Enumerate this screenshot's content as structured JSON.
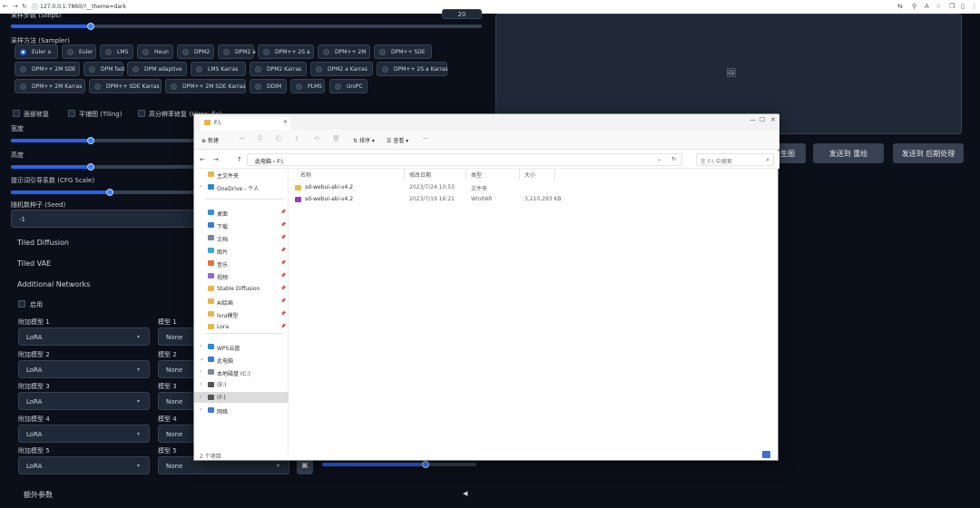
{
  "browser": {
    "url": "127.0.0.1:7860/?__theme=dark",
    "controls": [
      "←",
      "→",
      "↻",
      "ⓘ"
    ],
    "right_icons": [
      "⇆",
      "⚲",
      "A",
      "☆",
      "❒",
      "▯",
      "⋮"
    ]
  },
  "left": {
    "sampling_steps_label": "采样步数 (Steps)",
    "sampling_steps_value": "20",
    "sampling_steps_fraction": 0.17,
    "sampler_label": "采样方法 (Sampler)",
    "samplers": [
      "Euler a",
      "Euler",
      "LMS",
      "Heun",
      "DPM2",
      "DPM2 a",
      "DPM++ 2S a",
      "DPM++ 2M",
      "DPM++ SDE",
      "DPM++ 2M SDE",
      "DPM fast",
      "DPM adaptive",
      "LMS Karras",
      "DPM2 Karras",
      "DPM2 a Karras",
      "DPM++ 2S a Karras",
      "DPM++ 2M Karras",
      "DPM++ SDE Karras",
      "DPM++ 2M SDE Karras",
      "DDIM",
      "PLMS",
      "UniPC"
    ],
    "selected_sampler": "Euler a",
    "checkboxes": [
      "面部修复",
      "平铺图 (Tiling)",
      "高分辨率修复 (Hires. fix)"
    ],
    "width_label": "宽度",
    "width_fraction": 0.17,
    "height_label": "高度",
    "height_fraction": 0.17,
    "cfg_label": "提示词引导系数 (CFG Scale)",
    "cfg_fraction": 0.21,
    "seed_label": "随机数种子 (Seed)",
    "seed_value": "-1",
    "tiled_diffusion": "Tiled Diffusion",
    "tiled_vae": "Tiled VAE",
    "additional_networks": "Additional Networks",
    "enable_label": "启用",
    "extra_params": "额外参数",
    "extra_arrow": "◀",
    "dropdown_arrow": "▾",
    "networks": [
      {
        "type_label": "附加模型 1",
        "type_value": "LoRA",
        "model_label": "模型 1",
        "model_value": "None"
      },
      {
        "type_label": "附加模型 2",
        "type_value": "LoRA",
        "model_label": "模型 2",
        "model_value": "None"
      },
      {
        "type_label": "附加模型 3",
        "type_value": "LoRA",
        "model_label": "模型 3",
        "model_value": "None"
      },
      {
        "type_label": "附加模型 4",
        "type_value": "LoRA",
        "model_label": "模型 4",
        "model_value": "None"
      },
      {
        "type_label": "附加模型 5",
        "type_value": "LoRA",
        "model_label": "模型 5",
        "model_value": "None"
      }
    ]
  },
  "right": {
    "image_placeholder_icon": "🖼",
    "buttons": [
      "生图",
      "发送到 重绘",
      "发送到 后期处理"
    ]
  },
  "explorer": {
    "tab_title": "F:\\",
    "window_controls": [
      "—",
      "☐",
      "✕"
    ],
    "commands": [
      "新建",
      "排序",
      "查看",
      "···"
    ],
    "command_icons": [
      "✂",
      "⎘",
      "⎗",
      "⇪",
      "⟲",
      "🗑"
    ],
    "command_carets": [
      "▾",
      "▾"
    ],
    "nav_buttons": [
      "←",
      "→",
      "↑"
    ],
    "path": "此电脑 › F:\\",
    "search_placeholder": "在 F:\\ 中搜索",
    "search_icon": "⌕",
    "nav_items": [
      {
        "label": "主文件夹",
        "color": "#e8b64c",
        "expand": "",
        "pin": ""
      },
      {
        "label": "OneDrive - 个人",
        "color": "#2c8ad8",
        "expand": "›",
        "pin": ""
      },
      {
        "label": "桌面",
        "color": "#3a8ee6",
        "expand": "",
        "pin": "📌"
      },
      {
        "label": "下载",
        "color": "#3a7bd5",
        "expand": "",
        "pin": "📌"
      },
      {
        "label": "文档",
        "color": "#7a8796",
        "expand": "",
        "pin": "📌"
      },
      {
        "label": "图片",
        "color": "#3fa6d8",
        "expand": "",
        "pin": "📌"
      },
      {
        "label": "音乐",
        "color": "#e8703a",
        "expand": "",
        "pin": "📌"
      },
      {
        "label": "视频",
        "color": "#8a6bd8",
        "expand": "",
        "pin": "📌"
      },
      {
        "label": "Stable Diffusion",
        "color": "#e8b64c",
        "expand": "",
        "pin": "📌"
      },
      {
        "label": "AI绘画",
        "color": "#e8b64c",
        "expand": "",
        "pin": "📌"
      },
      {
        "label": "lora模型",
        "color": "#e8b64c",
        "expand": "",
        "pin": "📌"
      },
      {
        "label": "Lora",
        "color": "#e8b64c",
        "expand": "",
        "pin": "📌"
      },
      {
        "label": "WPS云盘",
        "color": "#2c8ad8",
        "expand": "›",
        "pin": ""
      },
      {
        "label": "此电脑",
        "color": "#3a7bd5",
        "expand": "⌄",
        "pin": ""
      },
      {
        "label": "本地磁盘 (C:)",
        "color": "#7a8796",
        "expand": "›",
        "pin": ""
      },
      {
        "label": "(E:)",
        "color": "#555555",
        "expand": "›",
        "pin": ""
      },
      {
        "label": "(F:)",
        "color": "#555555",
        "expand": "›",
        "pin": ""
      },
      {
        "label": "网络",
        "color": "#3a7bd5",
        "expand": "›",
        "pin": ""
      }
    ],
    "columns": [
      "名称",
      "修改日期",
      "类型",
      "大小"
    ],
    "files": [
      {
        "name": "sd-webui-aki-v4.2",
        "date": "2023/7/24 10:53",
        "type": "文件夹",
        "size": "",
        "color": "#e8b64c"
      },
      {
        "name": "sd-webui-aki-v4.2",
        "date": "2023/7/19 16:21",
        "type": "WinRAR",
        "size": "3,210,293 KB",
        "color": "#9a3ab8"
      }
    ],
    "status": "2 个项目"
  }
}
